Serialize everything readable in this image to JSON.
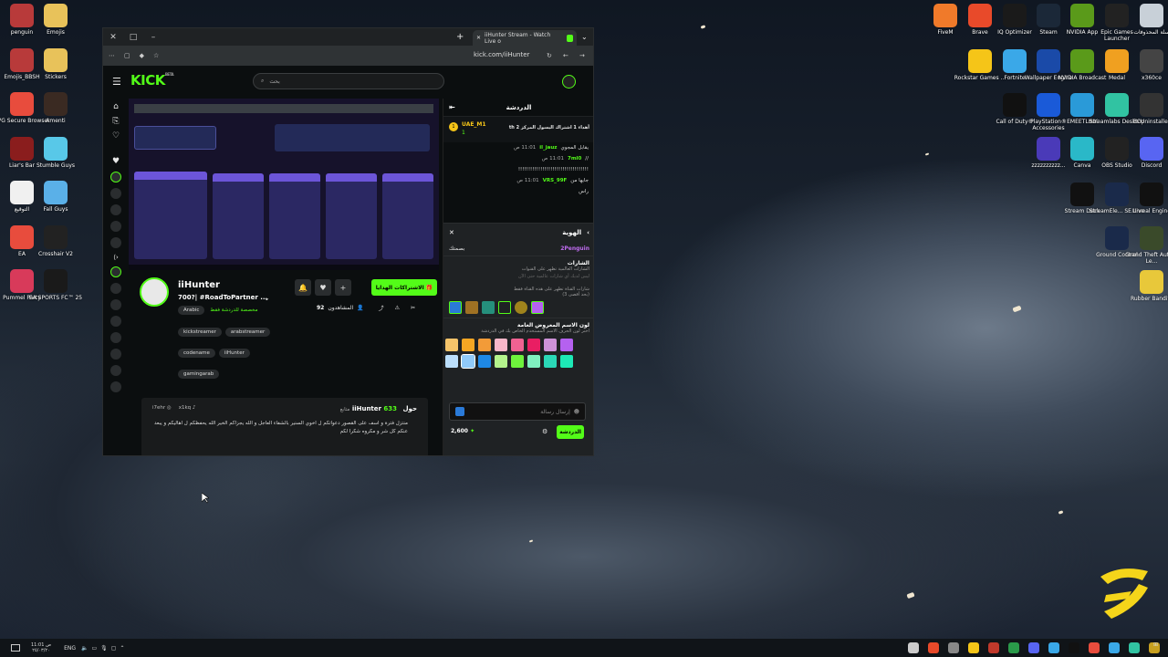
{
  "desktop_left": [
    {
      "label": "penguin",
      "color": "#b83a3a"
    },
    {
      "label": "Emojis",
      "color": "#e8c25a"
    },
    {
      "label": "Emojis_BBSH",
      "color": "#b83a3a"
    },
    {
      "label": "Stickers",
      "color": "#e8c25a"
    },
    {
      "label": "AVG Secure Browser",
      "color": "#e84c3d"
    },
    {
      "label": "Amenti",
      "color": "#3a2a22"
    },
    {
      "label": "Liar's Bar",
      "color": "#8a1d1d"
    },
    {
      "label": "Stumble Guys",
      "color": "#58c8e8"
    },
    {
      "label": "التوقيع",
      "color": "#f0f0f0"
    },
    {
      "label": "Fall Guys",
      "color": "#5ab0e8"
    },
    {
      "label": "EA",
      "color": "#e84c3d"
    },
    {
      "label": "Crosshair V2",
      "color": "#222"
    },
    {
      "label": "Pummel Party",
      "color": "#d83a5a"
    },
    {
      "label": "EA SPORTS FC™ 25",
      "color": "#1a1a1a"
    }
  ],
  "desktop_right": [
    {
      "label": "FiveM",
      "color": "#f07a2a"
    },
    {
      "label": "Brave",
      "color": "#e84a2a"
    },
    {
      "label": "IQ Optimizer",
      "color": "#1a1a1a"
    },
    {
      "label": "Steam",
      "color": "#1b2838"
    },
    {
      "label": "NVIDIA App",
      "color": "#5a9a1a"
    },
    {
      "label": "Epic Games Launcher",
      "color": "#222"
    },
    {
      "label": "سلة المحذوفات",
      "color": "#c8d0d8"
    },
    {
      "label": "Rockstar Games ...",
      "color": "#f5c518"
    },
    {
      "label": "Fortnite",
      "color": "#3aa8e8"
    },
    {
      "label": "Wallpaper Engine",
      "color": "#1a4aa8"
    },
    {
      "label": "NVIDIA Broadcast",
      "color": "#5a9a1a"
    },
    {
      "label": "Medal",
      "color": "#f0a020"
    },
    {
      "label": "x360ce",
      "color": "#444"
    },
    {
      "label": "Call of Duty®",
      "color": "#111"
    },
    {
      "label": "PlayStation® Accessories",
      "color": "#1a5ad8"
    },
    {
      "label": "EMEETLINK",
      "color": "#2a9ad8"
    },
    {
      "label": "Streamlabs Desktop",
      "color": "#31c3a2"
    },
    {
      "label": "BCUninstaller",
      "color": "#333"
    },
    {
      "label": "zzzzzzzzzz...",
      "color": "#4a3ab8"
    },
    {
      "label": "Canva",
      "color": "#2ab8c8"
    },
    {
      "label": "OBS Studio",
      "color": "#222"
    },
    {
      "label": "Discord",
      "color": "#5865f2"
    },
    {
      "label": "Stream Deck",
      "color": "#111"
    },
    {
      "label": "StreamEle... SE.Live",
      "color": "#1a2a4a"
    },
    {
      "label": "Unreal Engine",
      "color": "#111"
    },
    {
      "label": "Ground Control",
      "color": "#1a2a4a"
    },
    {
      "label": "Grand Theft Auto V Le...",
      "color": "#3a4a2a"
    },
    {
      "label": "Rubber Bandits",
      "color": "#e8c83a"
    }
  ],
  "browser": {
    "tab_title": "iiHunter Stream - Watch Live o",
    "url": "kick.com/iiHunter",
    "search_placeholder": "بحث"
  },
  "channel": {
    "name": "iiHunter",
    "title": "700?| #RoadToPartner ...",
    "language_tag": "Arabic",
    "mature_label": "مخصصة للدردشة فقط",
    "tags": [
      "kickstreamer",
      "arabstreamer",
      "codename",
      "iiHunter",
      "gamingarab"
    ],
    "subscribe_label": "الاشتراكات الهدايا",
    "viewers_label": "المشاهدون",
    "viewers_count": "92",
    "about_title": "حول iiHunter",
    "followers_count": "633",
    "followers_label": "متابع",
    "social1": "i7ehr",
    "social2": "x1kq",
    "about_text": "منتزل فترة و اسف على القصور دعواتكم ل اخوي السنير بالشفاء العاجل و الله يجزاكم الخير الله يحفظكم ل اهاليكم و يبعد عنكم كل شر و مكروه شكرا لكم"
  },
  "chat": {
    "header": "الدردشة",
    "pinned_user": "UAE_M1",
    "pinned_text": "أهداء 1 اشتراك اليسول المركز 2 th",
    "pinned_count": "1",
    "messages": [
      {
        "time": "11:01 ص",
        "user": "il_jauz",
        "text": "يقابل المجوي"
      },
      {
        "time": "11:01 ص",
        "user": "7ml0",
        "text": "//"
      },
      {
        "time": "",
        "user": "",
        "text": "!!!!!!!!!!!!!!!!!!!!!!!!!!!!!!!!!!!"
      },
      {
        "time": "11:01 ص",
        "user": "VRS_99F",
        "text": "جايها من"
      },
      {
        "time": "",
        "user": "",
        "text": "راس"
      }
    ],
    "id_panel_title": "الهوية",
    "identity_name": "2Penguin",
    "identity_name_label": "بصمتك",
    "badges_title": "الشارات",
    "badges_subtitle": "الشارات العالمية تظهر على القنوات",
    "badges_note": "ليس لديك أي شارات عالمية حتى الآن",
    "channel_badges_note": "شارات القناة تظهر على هذه القناة فقط",
    "channel_badges_sub": "(بحد أقصى 3)",
    "color_title": "لون الاسم المعروض العامة",
    "color_subtitle": "اختر لون الحرف الاسم المستخدم الخاص بك في الدردشة",
    "colors": [
      "#f5c46a",
      "#f5a623",
      "#f29b38",
      "#f8b7c9",
      "#f06292",
      "#e91e63",
      "#ce93d8",
      "#b561f0",
      "#bbdefb",
      "#90caf9",
      "#1e88e5",
      "#b4f38c",
      "#6ef23c",
      "#80f0c0",
      "#2bd8b8",
      "#1de9b6"
    ],
    "send_placeholder": "إرسال رسالة",
    "send_button": "الدردشة",
    "points": "2,600"
  },
  "taskbar": {
    "lang": "ENG",
    "time": "ص 11:01",
    "date": "٢٥/٠٣/٢٠"
  }
}
